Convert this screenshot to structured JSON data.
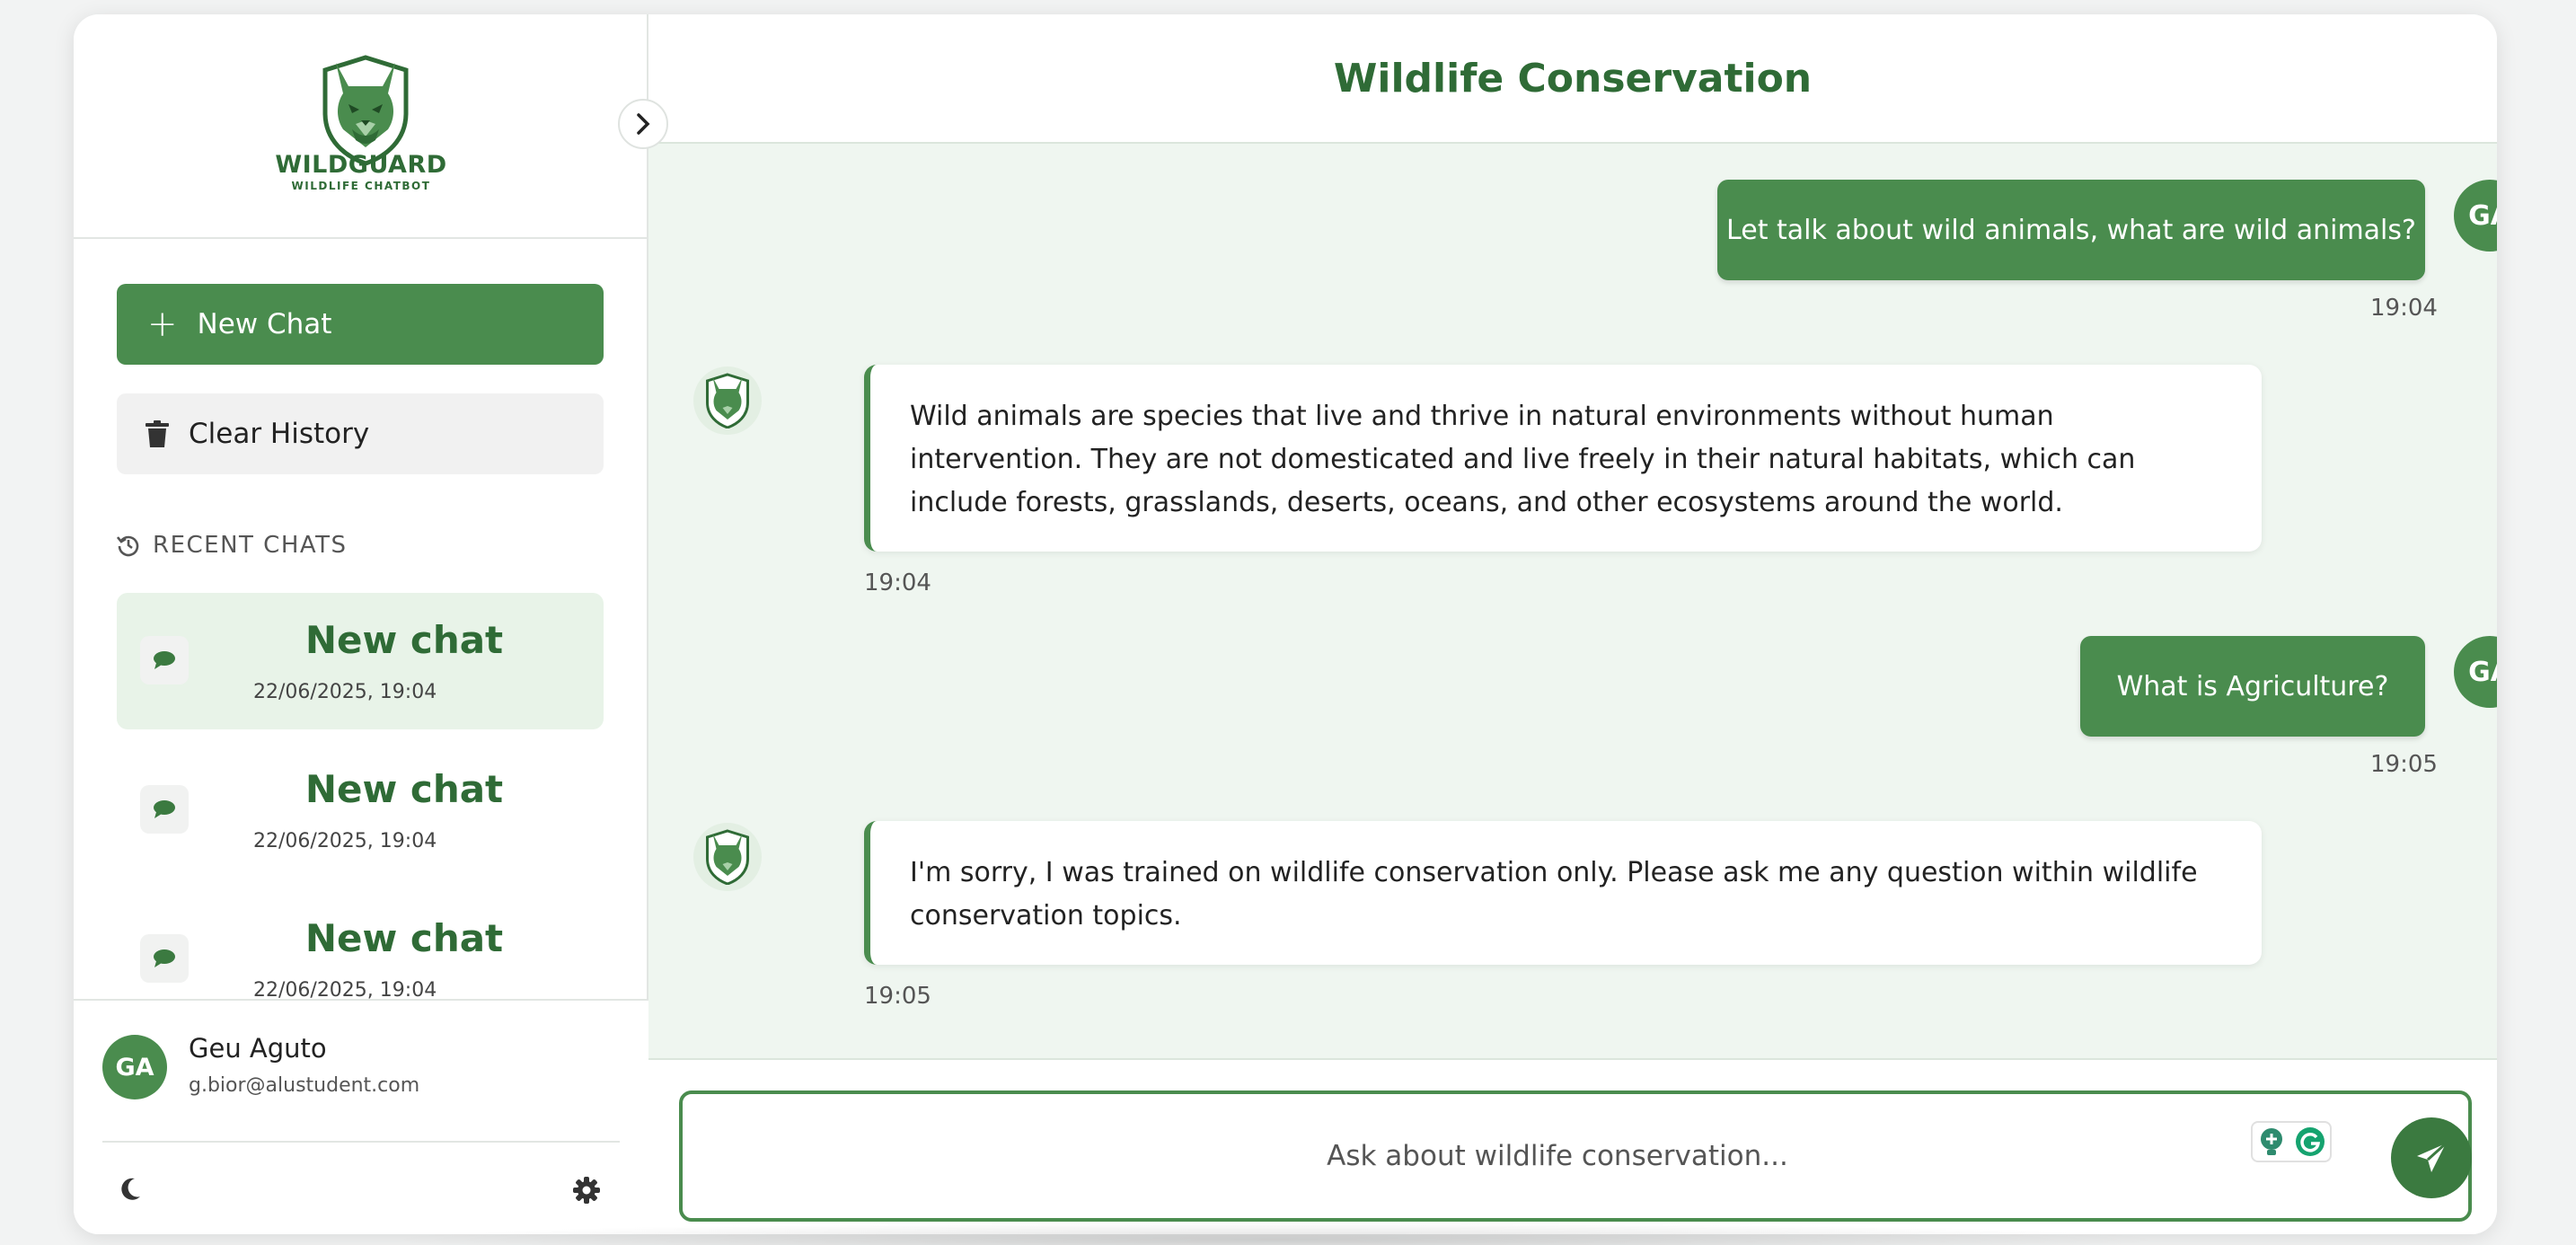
{
  "colors": {
    "brand": "#4a8c4e",
    "brand_dark": "#2f6b36",
    "chat_bg": "#eff6f0"
  },
  "sidebar": {
    "logo": {
      "title": "WILDGUARD",
      "subtitle": "WILDLIFE CHATBOT",
      "icon": "wolf-shield-logo"
    },
    "collapse_icon": "chevron-right-icon",
    "new_chat_label": "New Chat",
    "clear_history_label": "Clear History",
    "recent_heading": "RECENT CHATS",
    "chats": [
      {
        "title": "New chat",
        "date": "22/06/2025, 19:04"
      },
      {
        "title": "New chat",
        "date": "22/06/2025, 19:04"
      },
      {
        "title": "New chat",
        "date": "22/06/2025, 19:04"
      }
    ],
    "user": {
      "initials": "GA",
      "name": "Geu Aguto",
      "email": "g.bior@alustudent.com"
    }
  },
  "main": {
    "title": "Wildlife Conservation",
    "messages": [
      {
        "role": "user",
        "text": "Let talk about wild animals, what are wild animals?",
        "time": "19:04",
        "initials": "GA"
      },
      {
        "role": "bot",
        "text": "Wild animals are species that live and thrive in natural environments without human intervention. They are not domesticated and live freely in their natural habitats, which can include forests, grasslands, deserts, oceans, and other ecosystems around the world.",
        "time": "19:04"
      },
      {
        "role": "user",
        "text": "What is Agriculture?",
        "time": "19:05",
        "initials": "GA"
      },
      {
        "role": "bot",
        "text": "I'm sorry, I was trained on wildlife conservation only. Please ask me any question within wildlife conservation topics.",
        "time": "19:05"
      }
    ],
    "composer": {
      "placeholder": "Ask about wildlife conservation...",
      "value": ""
    }
  }
}
